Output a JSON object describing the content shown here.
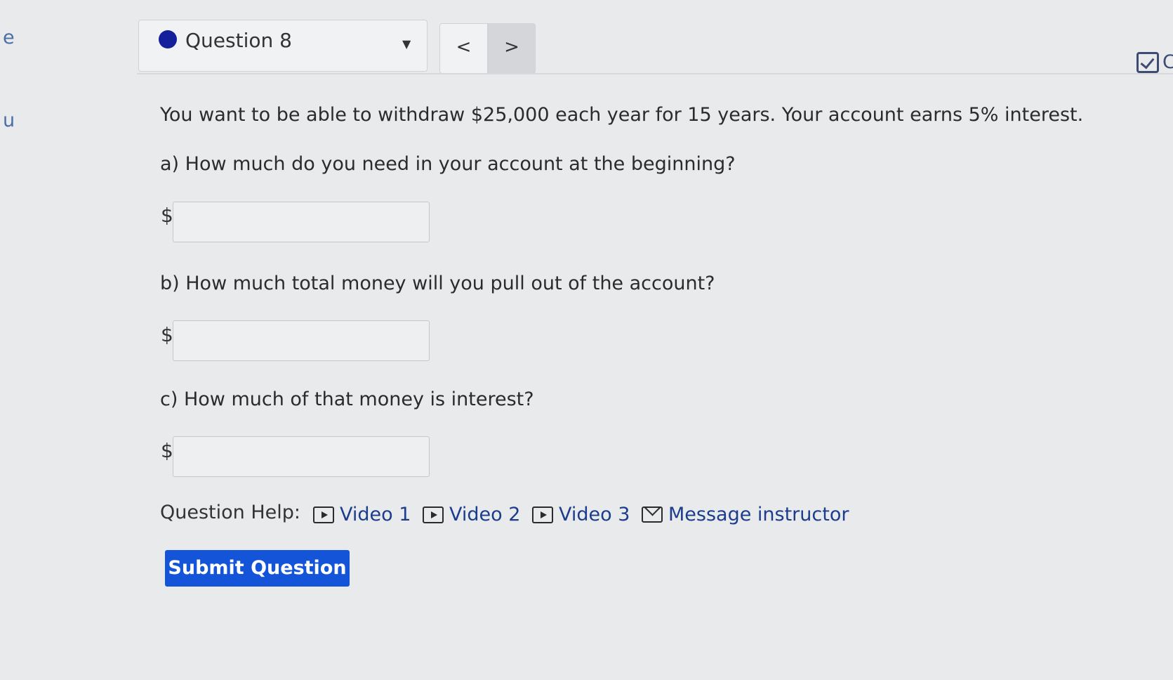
{
  "sidebar": {
    "letters": [
      "e",
      "u"
    ]
  },
  "header": {
    "question_label": "Question 8",
    "prev_symbol": "<",
    "next_symbol": ">",
    "corner_partial_text": "C"
  },
  "question": {
    "prompt": "You want to be able to withdraw $25,000 each year for 15 years. Your account earns 5% interest.",
    "parts": [
      {
        "label": "a) How much do you need in your account at the beginning?",
        "prefix": "$",
        "value": ""
      },
      {
        "label": "b) How much total money will you pull out of the account?",
        "prefix": "$",
        "value": ""
      },
      {
        "label": "c) How much of that money is interest?",
        "prefix": "$",
        "value": ""
      }
    ]
  },
  "help": {
    "label": "Question Help:",
    "links": [
      {
        "icon": "play-video-icon",
        "text": "Video 1"
      },
      {
        "icon": "play-video-icon",
        "text": "Video 2"
      },
      {
        "icon": "play-video-icon",
        "text": "Video 3"
      },
      {
        "icon": "mail-icon",
        "text": "Message instructor"
      }
    ]
  },
  "submit_label": "Submit Question",
  "colors": {
    "status_dot": "#141f9c",
    "link": "#1b3d8c",
    "submit_bg": "#1454d9"
  }
}
